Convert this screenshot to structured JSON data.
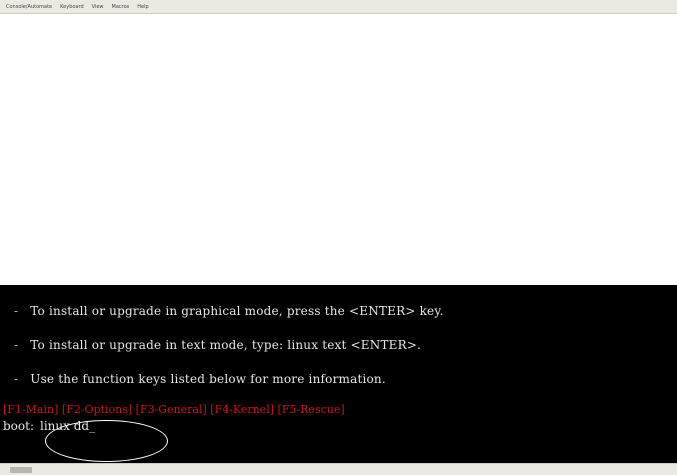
{
  "menu": {
    "items": [
      "Console/Automate",
      "Keyboard",
      "View",
      "Macros",
      "Help"
    ]
  },
  "console": {
    "lines": [
      "To install or upgrade in graphical mode, press the <ENTER> key.",
      "To install or upgrade in text mode, type: linux text <ENTER>.",
      "Use the function keys listed below for more information."
    ],
    "bullet": "-",
    "fkeys": "[F1-Main] [F2-Options] [F3-General] [F4-Kernel] [F5-Rescue]",
    "boot_prompt": "boot:",
    "boot_command": "linux dd_"
  },
  "colors": {
    "console_background": "#000000",
    "console_text": "#e6e6e6",
    "fkeys_text": "#c8161d",
    "callout_outline": "#ffffff"
  }
}
